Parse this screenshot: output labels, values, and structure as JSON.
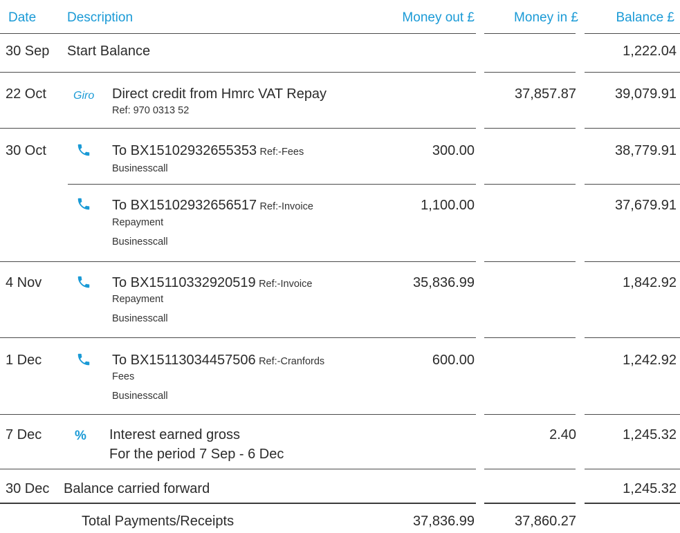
{
  "header": {
    "date": "Date",
    "description": "Description",
    "money_out": "Money out £",
    "money_in": "Money in £",
    "balance": "Balance £"
  },
  "start": {
    "date": "30 Sep",
    "label": "Start Balance",
    "balance": "1,222.04"
  },
  "rows": [
    {
      "date": "22 Oct",
      "icon": "giro",
      "icon_text": "Giro",
      "description": "Direct credit from Hmrc VAT Repay",
      "ref": "",
      "sub1": "Ref: 970 0313 52",
      "sub2": "",
      "money_out": "",
      "money_in": "37,857.87",
      "balance": "39,079.91"
    },
    {
      "date": "30 Oct",
      "icon": "phone",
      "description": "To BX15102932655353",
      "ref": "Ref:-Fees",
      "sub1": "Businesscall",
      "sub2": "",
      "money_out": "300.00",
      "money_in": "",
      "balance": "38,779.91"
    },
    {
      "date": "",
      "icon": "phone",
      "description": "To BX15102932656517",
      "ref": "Ref:-Invoice",
      "sub1": "Repayment",
      "sub2": "Businesscall",
      "money_out": "1,100.00",
      "money_in": "",
      "balance": "37,679.91"
    },
    {
      "date": "4 Nov",
      "icon": "phone",
      "description": "To BX15110332920519",
      "ref": "Ref:-Invoice",
      "sub1": "Repayment",
      "sub2": "Businesscall",
      "money_out": "35,836.99",
      "money_in": "",
      "balance": "1,842.92"
    },
    {
      "date": "1 Dec",
      "icon": "phone",
      "description": "To BX15113034457506",
      "ref": "Ref:-Cranfords",
      "sub1": "Fees",
      "sub2": "Businesscall",
      "money_out": "600.00",
      "money_in": "",
      "balance": "1,242.92"
    },
    {
      "date": "7 Dec",
      "icon": "percent",
      "icon_text": "%",
      "description": "Interest earned gross",
      "ref": "",
      "sub1": "For the period 7 Sep - 6 Dec",
      "sub2": "",
      "money_out": "",
      "money_in": "2.40",
      "balance": "1,245.32"
    }
  ],
  "carried": {
    "date": "30 Dec",
    "label": "Balance carried forward",
    "balance": "1,245.32"
  },
  "totals": {
    "label": "Total Payments/Receipts",
    "money_out": "37,836.99",
    "money_in": "37,860.27"
  },
  "colors": {
    "accent": "#1a9ad6",
    "text": "#2b2b2b"
  }
}
